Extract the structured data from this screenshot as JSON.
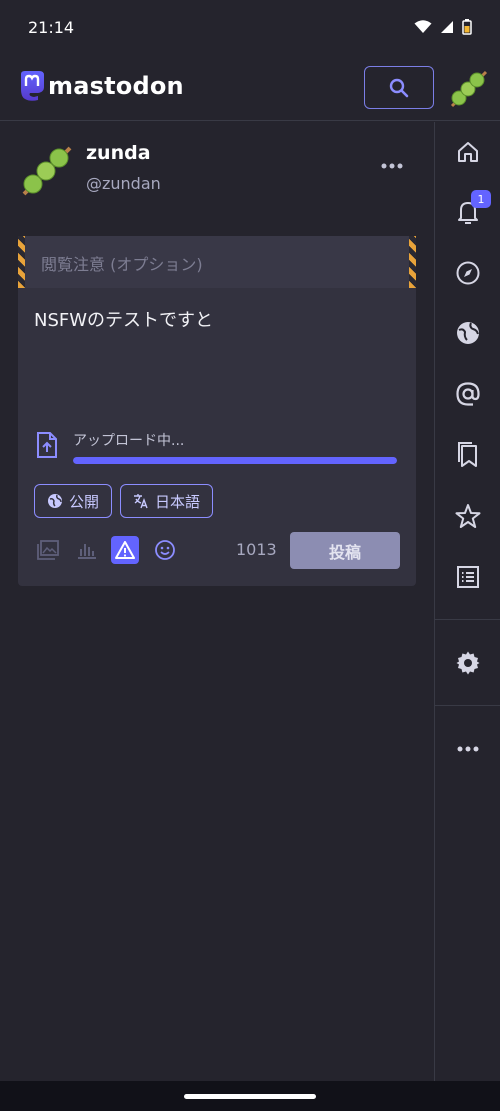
{
  "status_bar": {
    "time": "21:14"
  },
  "header": {
    "logo_text": "mastodon"
  },
  "profile": {
    "display_name": "zunda",
    "username": "@zundan"
  },
  "compose": {
    "cw_placeholder": "閲覧注意 (オプション)",
    "text": "NSFWのテストですと",
    "upload_label": "アップロード中...",
    "upload_progress": 1.0,
    "visibility_label": "公開",
    "language_label": "日本語",
    "char_count": "1013",
    "post_label": "投稿",
    "cw_active": true
  },
  "sidebar": {
    "notification_count": "1",
    "items": [
      "home",
      "notifications",
      "explore",
      "federated",
      "mentions",
      "bookmarks",
      "favourites",
      "lists",
      "preferences",
      "more"
    ]
  },
  "colors": {
    "accent": "#6364ff",
    "background": "#25242d",
    "compose_bg": "#33323f",
    "warning_stripe": "#e8a33a"
  }
}
